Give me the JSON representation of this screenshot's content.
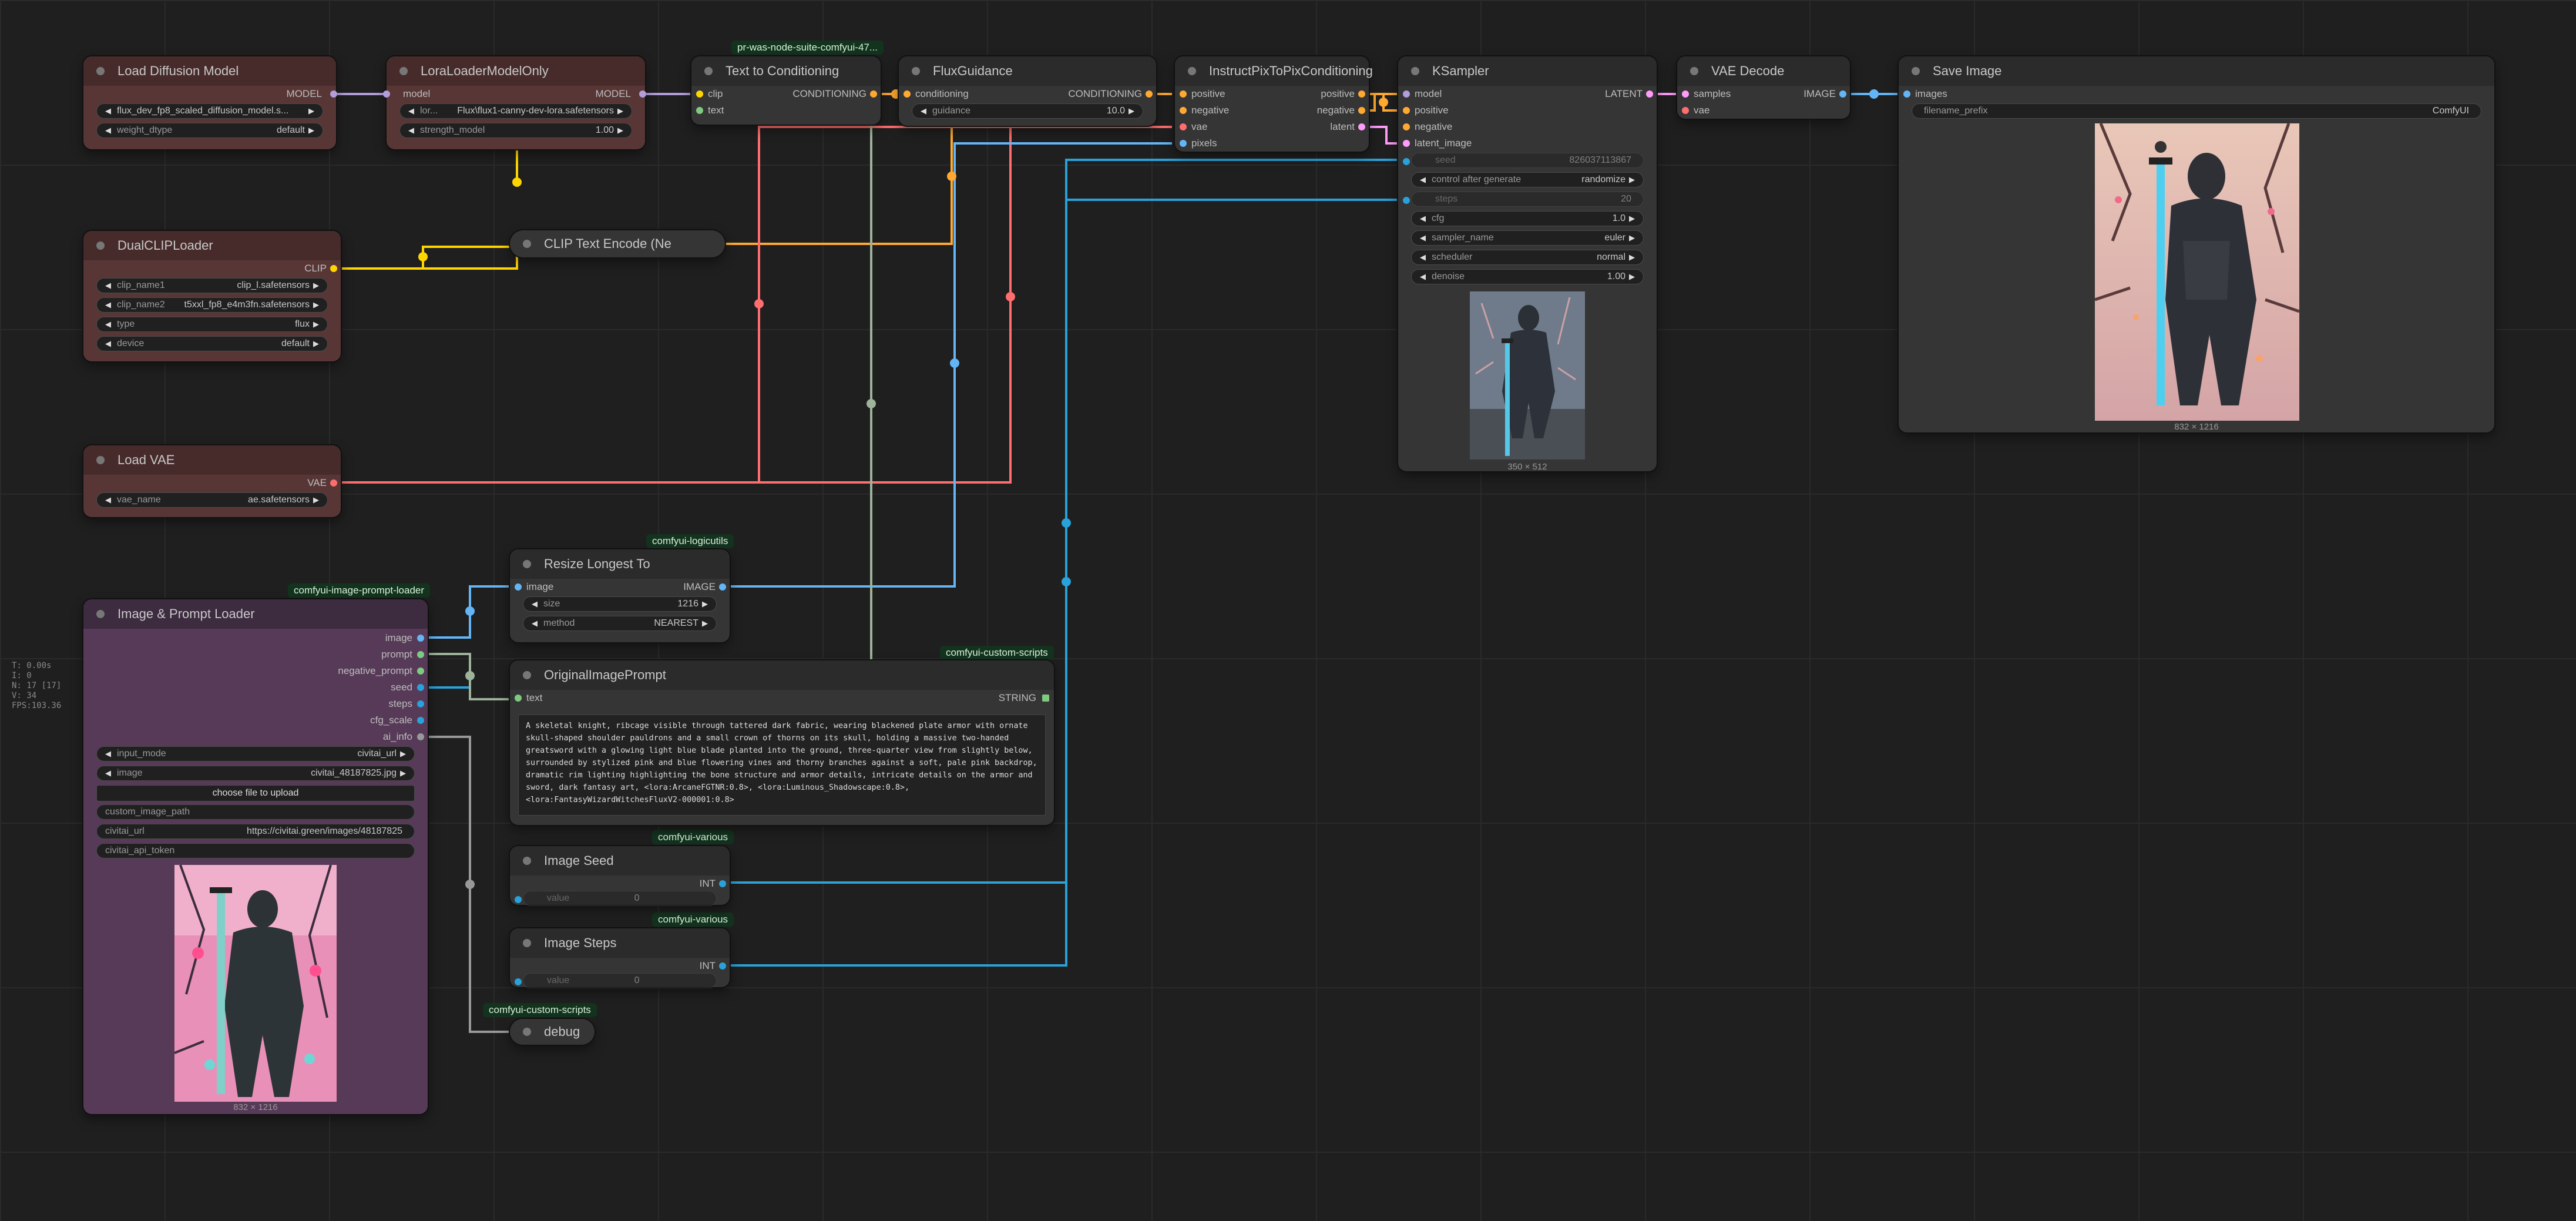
{
  "stats": [
    "T: 0.00s",
    "I: 0",
    "N: 17 [17]",
    "V: 34",
    "FPS:103.36"
  ],
  "tags": {
    "was": "pr-was-node-suite-comfyui-47...",
    "logicutils": "comfyui-logicutils",
    "image_prompt_loader": "comfyui-image-prompt-loader",
    "custom_scripts_1": "comfyui-custom-scripts",
    "various_1": "comfyui-various",
    "various_2": "comfyui-various",
    "custom_scripts_2": "comfyui-custom-scripts"
  },
  "nodes": {
    "load_diffusion": {
      "title": "Load Diffusion Model",
      "out_model": "MODEL",
      "unet_name": "flux_dev_fp8_scaled_diffusion_model.s...",
      "weight_dtype_label": "weight_dtype",
      "weight_dtype": "default"
    },
    "lora_loader": {
      "title": "LoraLoaderModelOnly",
      "in_model": "model",
      "out_model": "MODEL",
      "lora_label": "lor...",
      "lora_name": "Flux\\flux1-canny-dev-lora.safetensors",
      "strength_label": "strength_model",
      "strength": "1.00"
    },
    "text_to_cond": {
      "title": "Text to Conditioning",
      "in_clip": "clip",
      "in_text": "text",
      "out": "CONDITIONING"
    },
    "flux_guidance": {
      "title": "FluxGuidance",
      "in": "conditioning",
      "out": "CONDITIONING",
      "guidance_label": "guidance",
      "guidance": "10.0"
    },
    "ip2p": {
      "title": "InstructPixToPixConditioning",
      "in_positive": "positive",
      "in_negative": "negative",
      "in_vae": "vae",
      "in_pixels": "pixels",
      "out_positive": "positive",
      "out_negative": "negative",
      "out_latent": "latent"
    },
    "ksampler": {
      "title": "KSampler",
      "in_model": "model",
      "in_positive": "positive",
      "in_negative": "negative",
      "in_latent": "latent_image",
      "out": "LATENT",
      "seed_label": "seed",
      "seed": "826037113867",
      "cag_label": "control after generate",
      "cag": "randomize",
      "steps_label": "steps",
      "steps": "20",
      "cfg_label": "cfg",
      "cfg": "1.0",
      "sampler_label": "sampler_name",
      "sampler": "euler",
      "scheduler_label": "scheduler",
      "scheduler": "normal",
      "denoise_label": "denoise",
      "denoise": "1.00",
      "caption": "350 × 512"
    },
    "vae_decode": {
      "title": "VAE Decode",
      "in_samples": "samples",
      "in_vae": "vae",
      "out": "IMAGE"
    },
    "save_image": {
      "title": "Save Image",
      "in_images": "images",
      "prefix_label": "filename_prefix",
      "prefix": "ComfyUI",
      "caption": "832 × 1216"
    },
    "dual_clip": {
      "title": "DualCLIPLoader",
      "out": "CLIP",
      "clip1_label": "clip_name1",
      "clip1": "clip_l.safetensors",
      "clip2_label": "clip_name2",
      "clip2": "t5xxl_fp8_e4m3fn.safetensors",
      "type_label": "type",
      "type": "flux",
      "device_label": "device",
      "device": "default"
    },
    "clip_text_encode": {
      "title": "CLIP Text Encode (Ne"
    },
    "load_vae": {
      "title": "Load VAE",
      "out": "VAE",
      "vae_label": "vae_name",
      "vae": "ae.safetensors"
    },
    "resize": {
      "title": "Resize Longest To",
      "in_image": "image",
      "out": "IMAGE",
      "size_label": "size",
      "size": "1216",
      "method_label": "method",
      "method": "NEAREST"
    },
    "loader": {
      "title": "Image & Prompt Loader",
      "outputs": [
        "image",
        "prompt",
        "negative_prompt",
        "seed",
        "steps",
        "cfg_scale",
        "ai_info"
      ],
      "mode_label": "input_mode",
      "mode": "civitai_url",
      "image_label": "image",
      "image": "civitai_48187825.jpg",
      "upload": "choose file to upload",
      "path_label": "custom_image_path",
      "url_label": "civitai_url",
      "url": "https://civitai.green/images/48187825",
      "token_label": "civitai_api_token",
      "caption": "832 × 1216"
    },
    "original_prompt": {
      "title": "OriginalImagePrompt",
      "in_text": "text",
      "out": "STRING",
      "text": "A skeletal knight, ribcage visible through tattered dark fabric, wearing blackened plate armor with ornate skull-shaped shoulder pauldrons and a small crown of thorns on its skull, holding a massive two-handed greatsword with a glowing light blue blade planted into the ground, three-quarter view from slightly below, surrounded by stylized pink and blue flowering vines and thorny branches against a soft, pale pink backdrop, dramatic rim lighting highlighting the bone structure and armor details, intricate details on the armor and sword, dark fantasy art, <lora:ArcaneFGTNR:0.8>, <lora:Luminous_Shadowscape:0.8>, <lora:FantasyWizardWitchesFluxV2-000001:0.8>"
    },
    "image_seed": {
      "title": "Image Seed",
      "out": "INT",
      "value_label": "value",
      "value": "0"
    },
    "image_steps": {
      "title": "Image Steps",
      "out": "INT",
      "value_label": "value",
      "value": "0"
    },
    "debug": {
      "title": "debug"
    }
  },
  "colors": {
    "model": "#b39ddb",
    "clip": "#ffd500",
    "vae": "#ff6e6e",
    "conditioning": "#ffa931",
    "latent": "#ff9cf9",
    "image": "#64b5f6",
    "int": "#29a1d9",
    "string": "#7ecb80",
    "any": "#999999"
  }
}
